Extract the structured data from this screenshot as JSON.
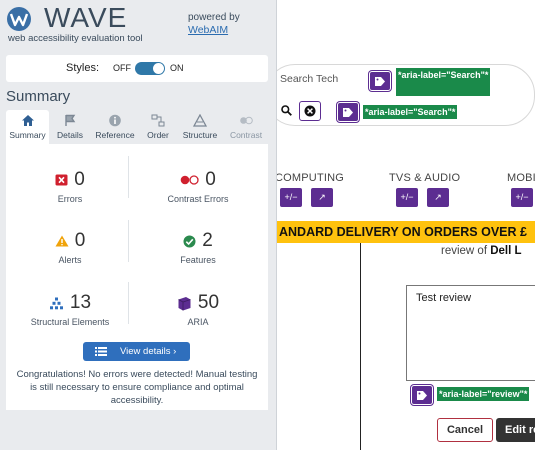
{
  "wave": {
    "title": "WAVE",
    "subtitle": "web accessibility evaluation tool",
    "powered_by": "powered by",
    "webaim_link": "WebAIM",
    "styles": {
      "label": "Styles:",
      "off": "OFF",
      "on": "ON",
      "enabled": true
    },
    "summary_heading": "Summary",
    "tabs": [
      {
        "label": "Summary",
        "icon": "home-icon",
        "active": true
      },
      {
        "label": "Details",
        "icon": "flag-icon"
      },
      {
        "label": "Reference",
        "icon": "info-icon"
      },
      {
        "label": "Order",
        "icon": "order-icon"
      },
      {
        "label": "Structure",
        "icon": "structure-icon"
      },
      {
        "label": "Contrast",
        "icon": "contrast-icon",
        "dim": true
      }
    ],
    "stats": {
      "errors": {
        "value": "0",
        "label": "Errors",
        "icon": "error-icon"
      },
      "contrast_errors": {
        "value": "0",
        "label": "Contrast Errors",
        "icon": "contrast-error-icon"
      },
      "alerts": {
        "value": "0",
        "label": "Alerts",
        "icon": "alert-icon"
      },
      "features": {
        "value": "2",
        "label": "Features",
        "icon": "feature-check-icon"
      },
      "structural": {
        "value": "13",
        "label": "Structural Elements",
        "icon": "structure-icon"
      },
      "aria": {
        "value": "50",
        "label": "ARIA",
        "icon": "aria-cube-icon"
      }
    },
    "view_details": "View details ›",
    "congrats": "Congratulations! No errors were detected! Manual testing is still necessary to ensure compliance and optimal accessibility."
  },
  "site": {
    "search_placeholder": "Search Tech",
    "aria_search_1": "*aria-label=\"Search\"*",
    "aria_search_2": "*aria-label=\"Search\"*",
    "categories": [
      "COMPUTING",
      "TVS & AUDIO",
      "MOBI"
    ],
    "banner": "ANDARD DELIVERY ON ORDERS OVER £",
    "review_of_prefix": "review of ",
    "review_of_product": "Dell L",
    "textarea_value": "Test review",
    "aria_review": "*aria-label=\"review\"*",
    "cancel_label": "Cancel",
    "edit_label": "Edit re"
  },
  "colors": {
    "wave_purple": "#5c2d91",
    "aria_green": "#1a8a4a",
    "banner_yellow": "#ffc20e",
    "button_blue": "#2f6fbd"
  }
}
